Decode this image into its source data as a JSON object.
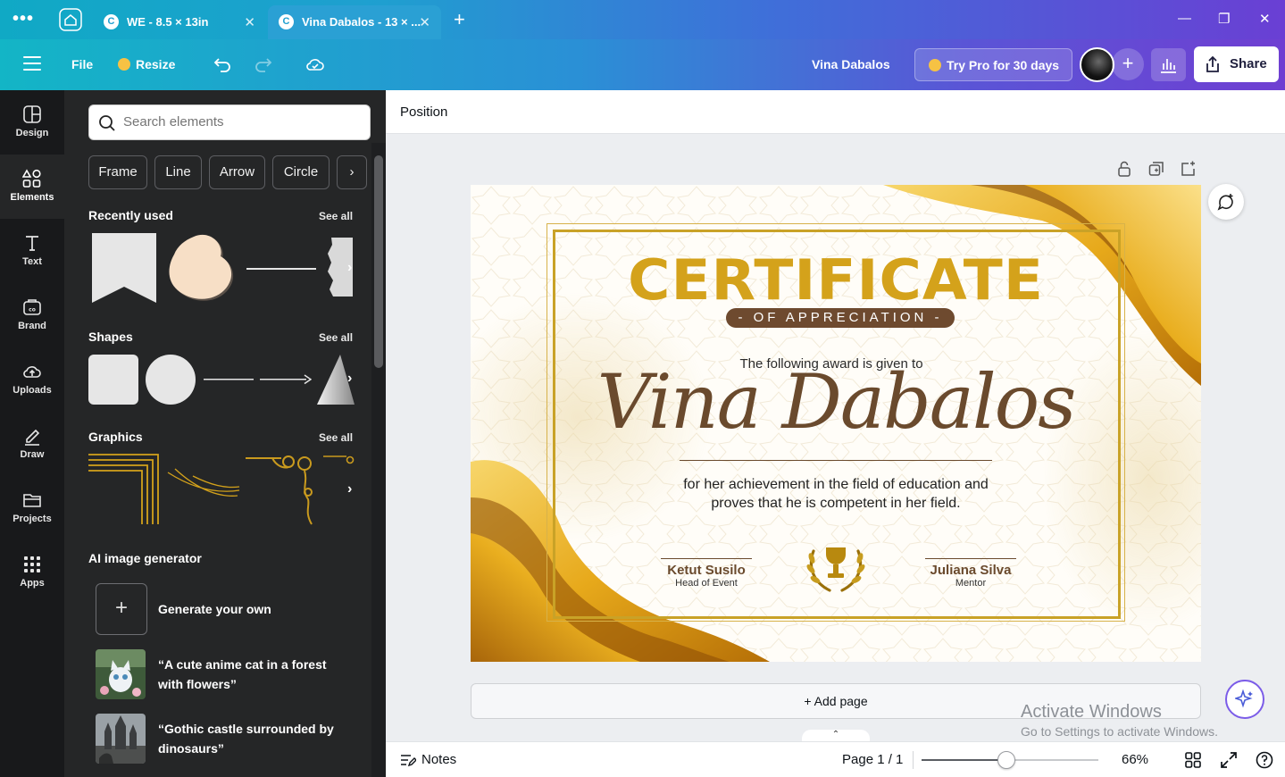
{
  "browser": {
    "tabs": [
      {
        "title": "WE - 8.5 × 13in"
      },
      {
        "title": "Vina Dabalos - 13 × ..."
      }
    ]
  },
  "topbar": {
    "file": "File",
    "resize": "Resize",
    "user_name": "Vina Dabalos",
    "try_pro": "Try Pro for 30 days",
    "share": "Share"
  },
  "rail": {
    "items": [
      {
        "label": "Design",
        "icon": "design-icon"
      },
      {
        "label": "Elements",
        "icon": "elements-icon"
      },
      {
        "label": "Text",
        "icon": "text-icon"
      },
      {
        "label": "Brand",
        "icon": "brand-icon"
      },
      {
        "label": "Uploads",
        "icon": "uploads-icon"
      },
      {
        "label": "Draw",
        "icon": "draw-icon"
      },
      {
        "label": "Projects",
        "icon": "projects-icon"
      },
      {
        "label": "Apps",
        "icon": "apps-icon"
      }
    ],
    "active": "Elements"
  },
  "panel": {
    "search_placeholder": "Search elements",
    "chips": [
      "Frame",
      "Line",
      "Arrow",
      "Circle"
    ],
    "recently_used": "Recently used",
    "shapes": "Shapes",
    "graphics": "Graphics",
    "see_all": "See all",
    "ai_generator": "AI image generator",
    "generate_own": "Generate your own",
    "prompt1_line1": "“A cute anime cat in a forest",
    "prompt1_line2": "with flowers”",
    "prompt2_line1": "“Gothic castle surrounded by",
    "prompt2_line2": "dinosaurs”"
  },
  "editor": {
    "position": "Position",
    "add_page": "+ Add page"
  },
  "certificate": {
    "title": "CERTIFICATE",
    "subtitle": "- OF APPRECIATION -",
    "given": "The following award is given to",
    "recipient": "Vina Dabalos",
    "achievement_line1": "for her achievement in the field of education and",
    "achievement_line2": "proves that he is competent in her field.",
    "sig1_name": "Ketut Susilo",
    "sig1_role": "Head of Event",
    "sig2_name": "Juliana Silva",
    "sig2_role": "Mentor",
    "colors": {
      "gold": "#d4a21b",
      "brown": "#6a4a2d"
    }
  },
  "watermark": {
    "line1": "Activate Windows",
    "line2": "Go to Settings to activate Windows."
  },
  "bottombar": {
    "notes": "Notes",
    "page": "Page 1 / 1",
    "zoom": "66%",
    "zoom_fraction": 0.48
  }
}
